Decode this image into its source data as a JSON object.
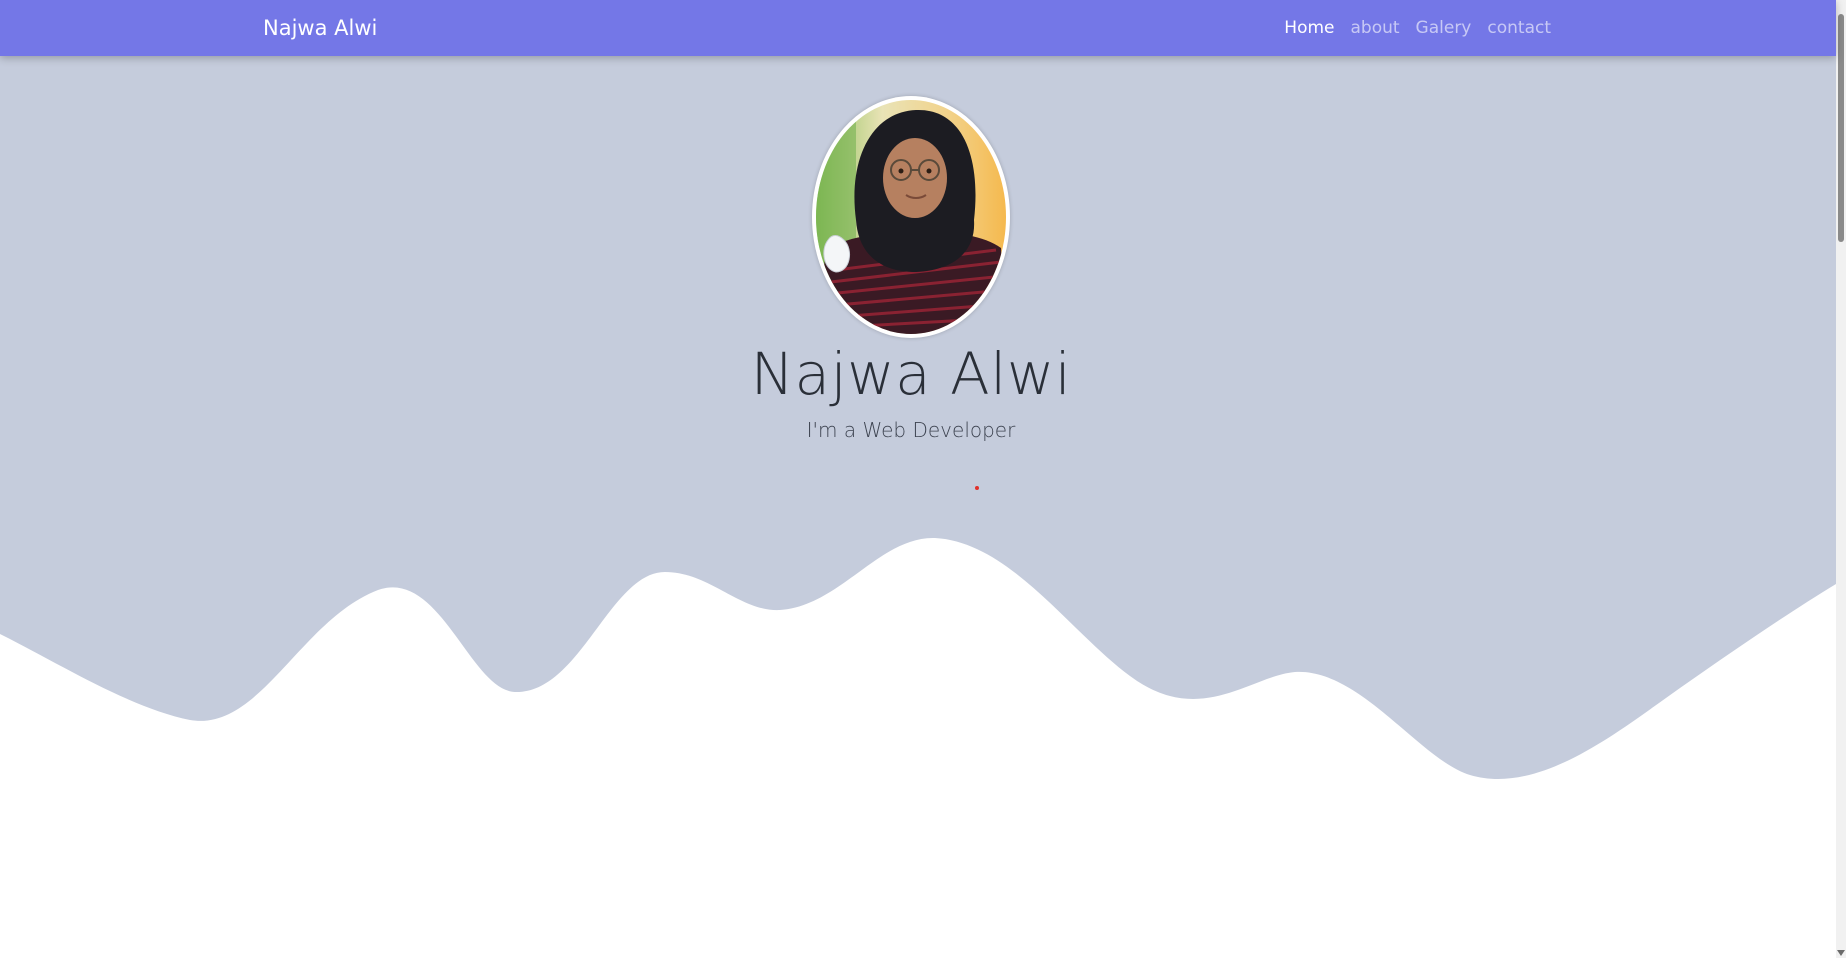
{
  "navbar": {
    "brand": "Najwa Alwi",
    "links": [
      {
        "label": "Home",
        "active": true
      },
      {
        "label": "about",
        "active": false
      },
      {
        "label": "Galery",
        "active": false
      },
      {
        "label": "contact",
        "active": false
      }
    ]
  },
  "hero": {
    "name": "Najwa Alwi",
    "role": "I'm a Web Developer",
    "avatar_icon": "profile-photo"
  },
  "colors": {
    "navbar": "#7477e7",
    "hero_background": "#c5ccdc",
    "wave": "#ffffff",
    "accent_dot": "#e0312c"
  }
}
